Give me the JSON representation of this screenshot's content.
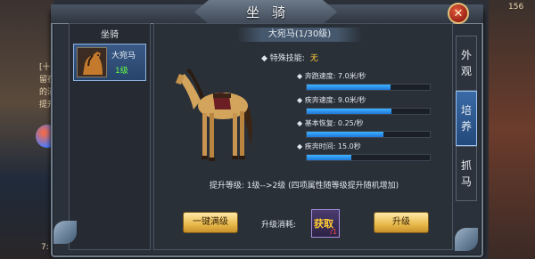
{
  "window": {
    "title": "坐骑",
    "close_glyph": "✕"
  },
  "sidebar": {
    "header": "坐骑",
    "items": [
      {
        "name": "大宛马",
        "level": "1级",
        "selected": true
      }
    ]
  },
  "detail": {
    "banner": "大宛马(1/30级)",
    "skill_label": "◆ 特殊技能:",
    "skill_value": "无",
    "stats": [
      {
        "label": "◆ 奔跑速度: 7.0米/秒",
        "fill": 0.68
      },
      {
        "label": "◆ 疾奔速度: 9.0米/秒",
        "fill": 0.69
      },
      {
        "label": "◆ 基本恢复: 0.25/秒",
        "fill": 0.62
      },
      {
        "label": "◆ 疾奔时间: 15.0秒",
        "fill": 0.36
      }
    ],
    "upgrade_text": "提升等级: 1级-->2级 (四项属性随等级提升随机增加)",
    "one_click_button": "一键满级",
    "cost_label": "升级消耗:",
    "cost_item_glyph": "获取",
    "cost_item_count": "/1",
    "upgrade_button": "升级"
  },
  "tabs": [
    {
      "label": "外观",
      "active": false
    },
    {
      "label": "培养",
      "active": true
    },
    {
      "label": "抓马",
      "active": false
    }
  ],
  "scene": {
    "left_lines": [
      "[十一",
      "留在帮",
      "的消息",
      "提升"
    ],
    "bottom_left": "7:",
    "top_right": "156"
  },
  "colors": {
    "bar_fill": "#2f9cf0",
    "skill_value": "#ffcf33",
    "level_text": "#66ff44",
    "gold_button": "#e8b94b"
  }
}
